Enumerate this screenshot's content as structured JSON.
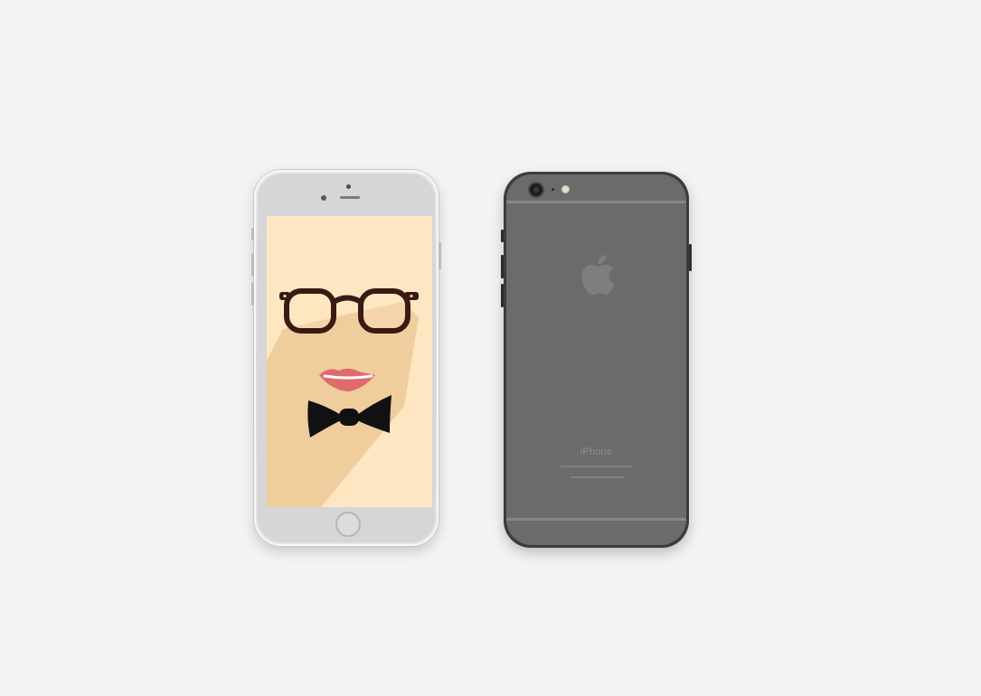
{
  "scene": {
    "background_color": "#f3f3f3"
  },
  "front_phone": {
    "body_color": "#e3e3e5",
    "screen": {
      "background_color": "#fde6c1",
      "shadow_color": "#efcd9d",
      "glasses_color": "#3a1a14",
      "lips_color": "#e06a6e",
      "bow_tie_color": "#111111"
    }
  },
  "back_phone": {
    "body_color": "#6b6b6c",
    "logo_icon": "apple-logo-icon",
    "brand_label": "iPhone"
  }
}
